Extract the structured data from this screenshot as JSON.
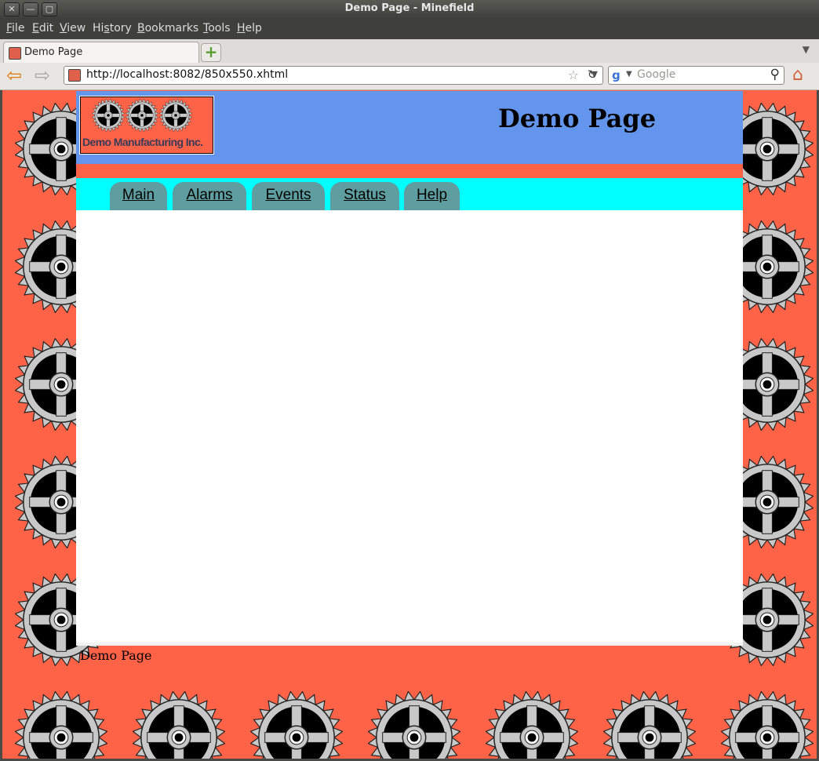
{
  "window": {
    "title": "Demo Page - Minefield",
    "buttons": [
      "✕",
      "—",
      "▢"
    ]
  },
  "menu": {
    "items": [
      {
        "accel": "F",
        "rest": "ile"
      },
      {
        "accel": "E",
        "rest": "dit"
      },
      {
        "accel": "V",
        "rest": "iew"
      },
      {
        "pre": "Hi",
        "accel": "s",
        "rest": "tory"
      },
      {
        "accel": "B",
        "rest": "ookmarks"
      },
      {
        "accel": "T",
        "rest": "ools"
      },
      {
        "accel": "H",
        "rest": "elp"
      }
    ]
  },
  "tabs": {
    "active_label": "Demo Page",
    "new_tab_symbol": "+",
    "list_symbol": "▼"
  },
  "toolbar": {
    "back_symbol": "⇦",
    "forward_symbol": "⇨",
    "url": "http://localhost:8082/850x550.xhtml",
    "bookmark_star": "☆",
    "url_dropdown": "▼",
    "reload_symbol": "↻",
    "search_engine_glyph": "g",
    "search_dropdown": "▼",
    "search_placeholder": "Google",
    "search_icon_glyph": "⚲",
    "home_symbol": "⌂"
  },
  "page": {
    "company_name": "Demo Manufacturing Inc.",
    "title": "Demo Page",
    "nav": [
      "Main",
      "Alarms",
      "Events",
      "Status",
      "Help"
    ],
    "footer": "Demo Page"
  },
  "colors": {
    "page_background": "#ff6347",
    "header": "#6495ed",
    "nav_strip": "#00ffff",
    "nav_tab": "#5f9ea0",
    "content": "#ffffff"
  }
}
